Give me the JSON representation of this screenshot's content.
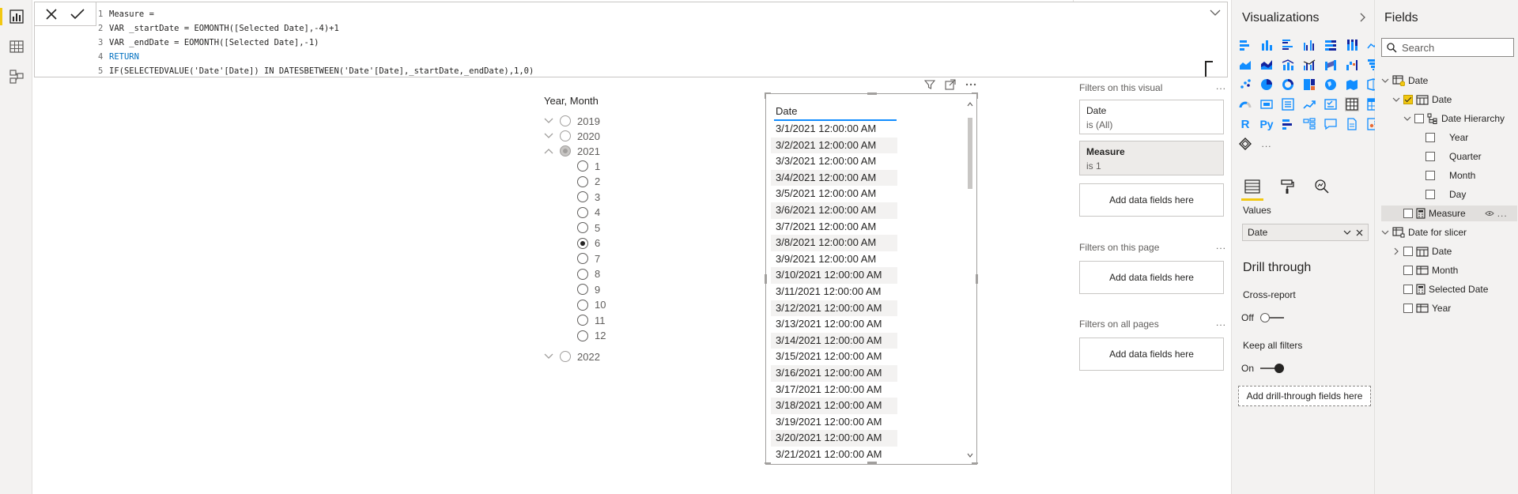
{
  "formula": {
    "lines": [
      {
        "n": "1",
        "text": "Measure ="
      },
      {
        "n": "2",
        "text": "VAR _startDate = EOMONTH([Selected Date],-4)+1"
      },
      {
        "n": "3",
        "text": "VAR _endDate = EOMONTH([Selected Date],-1)"
      },
      {
        "n": "4",
        "text": "RETURN"
      },
      {
        "n": "5",
        "text": "IF(SELECTEDVALUE('Date'[Date]) IN DATESBETWEEN('Date'[Date],_startDate,_endDate),1,0)"
      }
    ],
    "cancel_icon": "close-icon",
    "commit_icon": "check-icon"
  },
  "slicer": {
    "title": "Year, Month",
    "years": [
      "2019",
      "2020",
      "2021",
      "2022"
    ],
    "months": [
      "1",
      "2",
      "3",
      "4",
      "5",
      "6",
      "7",
      "8",
      "9",
      "10",
      "11",
      "12"
    ],
    "selected_month": "6"
  },
  "table": {
    "header": "Date",
    "rows": [
      "3/1/2021 12:00:00 AM",
      "3/2/2021 12:00:00 AM",
      "3/3/2021 12:00:00 AM",
      "3/4/2021 12:00:00 AM",
      "3/5/2021 12:00:00 AM",
      "3/6/2021 12:00:00 AM",
      "3/7/2021 12:00:00 AM",
      "3/8/2021 12:00:00 AM",
      "3/9/2021 12:00:00 AM",
      "3/10/2021 12:00:00 AM",
      "3/11/2021 12:00:00 AM",
      "3/12/2021 12:00:00 AM",
      "3/13/2021 12:00:00 AM",
      "3/14/2021 12:00:00 AM",
      "3/15/2021 12:00:00 AM",
      "3/16/2021 12:00:00 AM",
      "3/17/2021 12:00:00 AM",
      "3/18/2021 12:00:00 AM",
      "3/19/2021 12:00:00 AM",
      "3/20/2021 12:00:00 AM",
      "3/21/2021 12:00:00 AM"
    ]
  },
  "filters": {
    "on_visual": "Filters on this visual",
    "on_page": "Filters on this page",
    "on_all": "Filters on all pages",
    "more": "...",
    "cards": [
      {
        "name": "Date",
        "value": "is (All)"
      },
      {
        "name": "Measure",
        "value": "is 1"
      }
    ],
    "add_here": "Add data fields here"
  },
  "visualizations": {
    "title": "Visualizations",
    "values_label": "Values",
    "values_field": "Date",
    "drill_title": "Drill through",
    "cross_report": "Cross-report",
    "cross_report_state": "Off",
    "keep_filters": "Keep all filters",
    "keep_filters_state": "On",
    "drill_add": "Add drill-through fields here",
    "more": "..."
  },
  "fields": {
    "title": "Fields",
    "search_placeholder": "Search",
    "tree": {
      "date_table": "Date",
      "date_field": "Date",
      "hierarchy": "Date Hierarchy",
      "h_levels": [
        "Year",
        "Quarter",
        "Month",
        "Day"
      ],
      "measure": "Measure",
      "slicer_table": "Date for slicer",
      "slicer_fields": [
        "Date",
        "Month",
        "Selected Date",
        "Year"
      ]
    }
  }
}
